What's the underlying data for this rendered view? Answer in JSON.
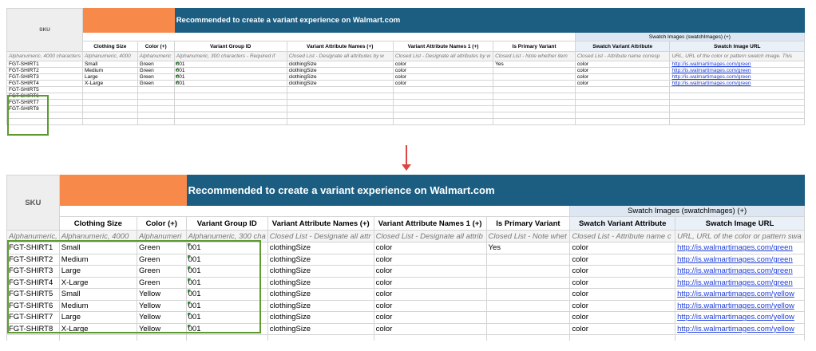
{
  "sheet": {
    "sku_header": "SKU",
    "banner_title": "Recommended to create a variant experience on Walmart.com",
    "swatch_group_header": "Swatch Images (swatchImages) (+)",
    "column_headers": [
      "Clothing Size",
      "Color (+)",
      "Variant Group ID",
      "Variant Attribute Names (+)",
      "Variant Attribute Names 1 (+)",
      "Is Primary Variant",
      "Swatch Variant Attribute",
      "Swatch Image URL"
    ],
    "top_descriptions": [
      "Alphanumeric, 4000 characters",
      "Alphanumeric, 4000",
      "Alphanumeric",
      "Alphanumeric, 300 characters - Required if",
      "Closed List - Designate all attributes by w",
      "Closed List - Designate all attributes by w",
      "Closed List - Note whether item",
      "Closed List - Attribute name corresp",
      "URL, URL of the color or pattern swatch image. This"
    ],
    "bottom_descriptions": [
      "Alphanumeric,",
      "Alphanumeric, 4000",
      "Alphanumeri",
      "Alphanumeric, 300 cha",
      "Closed List - Designate all attr",
      "Closed List - Designate all attrib",
      "Closed List - Note whet",
      "Closed List - Attribute name c",
      "URL, URL of the color or pattern swa"
    ]
  },
  "top_rows": [
    {
      "sku": "FGT-SHIRT1",
      "size": "Small",
      "color": "Green",
      "group": "001",
      "names": "clothingSize",
      "names1": "color",
      "primary": "Yes",
      "swatch_attr": "color",
      "url": "http://is.walmartimages.com/green"
    },
    {
      "sku": "FGT-SHIRT2",
      "size": "Medium",
      "color": "Green",
      "group": "001",
      "names": "clothingSize",
      "names1": "color",
      "primary": "",
      "swatch_attr": "color",
      "url": "http://is.walmartimages.com/green"
    },
    {
      "sku": "FGT-SHIRT3",
      "size": "Large",
      "color": "Green",
      "group": "001",
      "names": "clothingSize",
      "names1": "color",
      "primary": "",
      "swatch_attr": "color",
      "url": "http://is.walmartimages.com/green"
    },
    {
      "sku": "FGT-SHIRT4",
      "size": "X-Large",
      "color": "Green",
      "group": "001",
      "names": "clothingSize",
      "names1": "color",
      "primary": "",
      "swatch_attr": "color",
      "url": "http://is.walmartimages.com/green"
    },
    {
      "sku": "FGT-SHIRT5",
      "size": "",
      "color": "",
      "group": "",
      "names": "",
      "names1": "",
      "primary": "",
      "swatch_attr": "",
      "url": ""
    },
    {
      "sku": "FGT-SHIRT6",
      "size": "",
      "color": "",
      "group": "",
      "names": "",
      "names1": "",
      "primary": "",
      "swatch_attr": "",
      "url": ""
    },
    {
      "sku": "FGT-SHIRT7",
      "size": "",
      "color": "",
      "group": "",
      "names": "",
      "names1": "",
      "primary": "",
      "swatch_attr": "",
      "url": ""
    },
    {
      "sku": "FGT-SHIRT8",
      "size": "",
      "color": "",
      "group": "",
      "names": "",
      "names1": "",
      "primary": "",
      "swatch_attr": "",
      "url": ""
    }
  ],
  "bottom_rows": [
    {
      "sku": "FGT-SHIRT1",
      "size": "Small",
      "color": "Green",
      "group": "001",
      "names": "clothingSize",
      "names1": "color",
      "primary": "Yes",
      "swatch_attr": "color",
      "url": "http://is.walmartimages.com/green"
    },
    {
      "sku": "FGT-SHIRT2",
      "size": "Medium",
      "color": "Green",
      "group": "001",
      "names": "clothingSize",
      "names1": "color",
      "primary": "",
      "swatch_attr": "color",
      "url": "http://is.walmartimages.com/green"
    },
    {
      "sku": "FGT-SHIRT3",
      "size": "Large",
      "color": "Green",
      "group": "001",
      "names": "clothingSize",
      "names1": "color",
      "primary": "",
      "swatch_attr": "color",
      "url": "http://is.walmartimages.com/green"
    },
    {
      "sku": "FGT-SHIRT4",
      "size": "X-Large",
      "color": "Green",
      "group": "001",
      "names": "clothingSize",
      "names1": "color",
      "primary": "",
      "swatch_attr": "color",
      "url": "http://is.walmartimages.com/green"
    },
    {
      "sku": "FGT-SHIRT5",
      "size": "Small",
      "color": "Yellow",
      "group": "001",
      "names": "clothingSize",
      "names1": "color",
      "primary": "",
      "swatch_attr": "color",
      "url": "http://is.walmartimages.com/yellow"
    },
    {
      "sku": "FGT-SHIRT6",
      "size": "Medium",
      "color": "Yellow",
      "group": "001",
      "names": "clothingSize",
      "names1": "color",
      "primary": "",
      "swatch_attr": "color",
      "url": "http://is.walmartimages.com/yellow"
    },
    {
      "sku": "FGT-SHIRT7",
      "size": "Large",
      "color": "Yellow",
      "group": "001",
      "names": "clothingSize",
      "names1": "color",
      "primary": "",
      "swatch_attr": "color",
      "url": "http://is.walmartimages.com/yellow"
    },
    {
      "sku": "FGT-SHIRT8",
      "size": "X-Large",
      "color": "Yellow",
      "group": "001",
      "names": "clothingSize",
      "names1": "color",
      "primary": "",
      "swatch_attr": "color",
      "url": "http://is.walmartimages.com/yellow"
    }
  ],
  "colors": {
    "banner_bg": "#1c5e82",
    "orange_block": "#f7894a",
    "highlight_border": "#5c9a2f",
    "arrow": "#dd4444",
    "link": "#1f3fd9"
  }
}
